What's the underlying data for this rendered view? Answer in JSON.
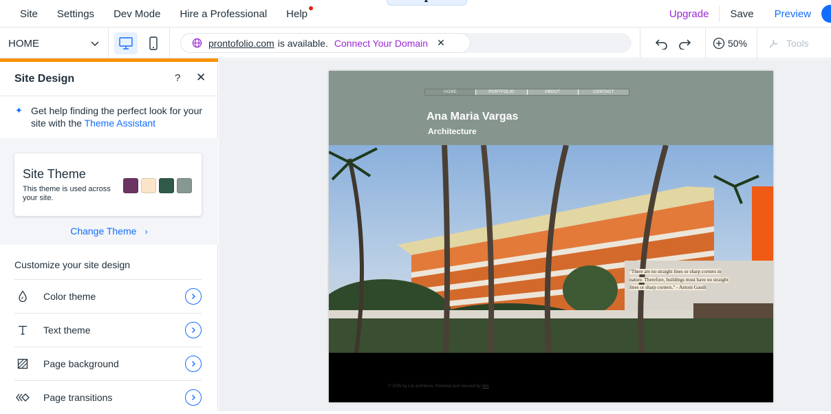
{
  "topbar": {
    "menu": [
      "Site",
      "Settings",
      "Dev Mode",
      "Hire a Professional",
      "Help"
    ],
    "upgrade": "Upgrade",
    "save": "Save",
    "preview": "Preview"
  },
  "toolbar": {
    "page": "HOME",
    "domain": "prontofolio.com",
    "available_text": "is available.",
    "connect": "Connect Your Domain",
    "zoom": "50%",
    "tools": "Tools"
  },
  "panel": {
    "title": "Site Design",
    "help": "?",
    "assistant_text": "Get help finding the perfect look for your site with the ",
    "assistant_link": "Theme Assistant",
    "theme_title": "Site Theme",
    "theme_desc": "This theme is used across your site.",
    "theme_colors": [
      "#6b3563",
      "#fbe4c9",
      "#2e5a47",
      "#879791"
    ],
    "change_theme": "Change Theme",
    "customize_heading": "Customize your site design",
    "options": [
      {
        "label": "Color theme",
        "icon": "droplet-icon"
      },
      {
        "label": "Text theme",
        "icon": "text-icon"
      },
      {
        "label": "Page background",
        "icon": "background-icon"
      },
      {
        "label": "Page transitions",
        "icon": "transitions-icon"
      }
    ]
  },
  "site": {
    "nav": [
      "HOME",
      "PORTFOLIO",
      "ABOUT",
      "CONTACT"
    ],
    "name": "Ana Maria Vargas",
    "subtitle": "Architecture",
    "quote": "\"There are no straight lines or sharp corners in nature. Therefore, buildings must have no straight lines or sharp corners.\" - Antoni Gaudi",
    "footer": "© 2035 by L&I architects. Powered and secured by ",
    "footer_link": "Wix"
  }
}
